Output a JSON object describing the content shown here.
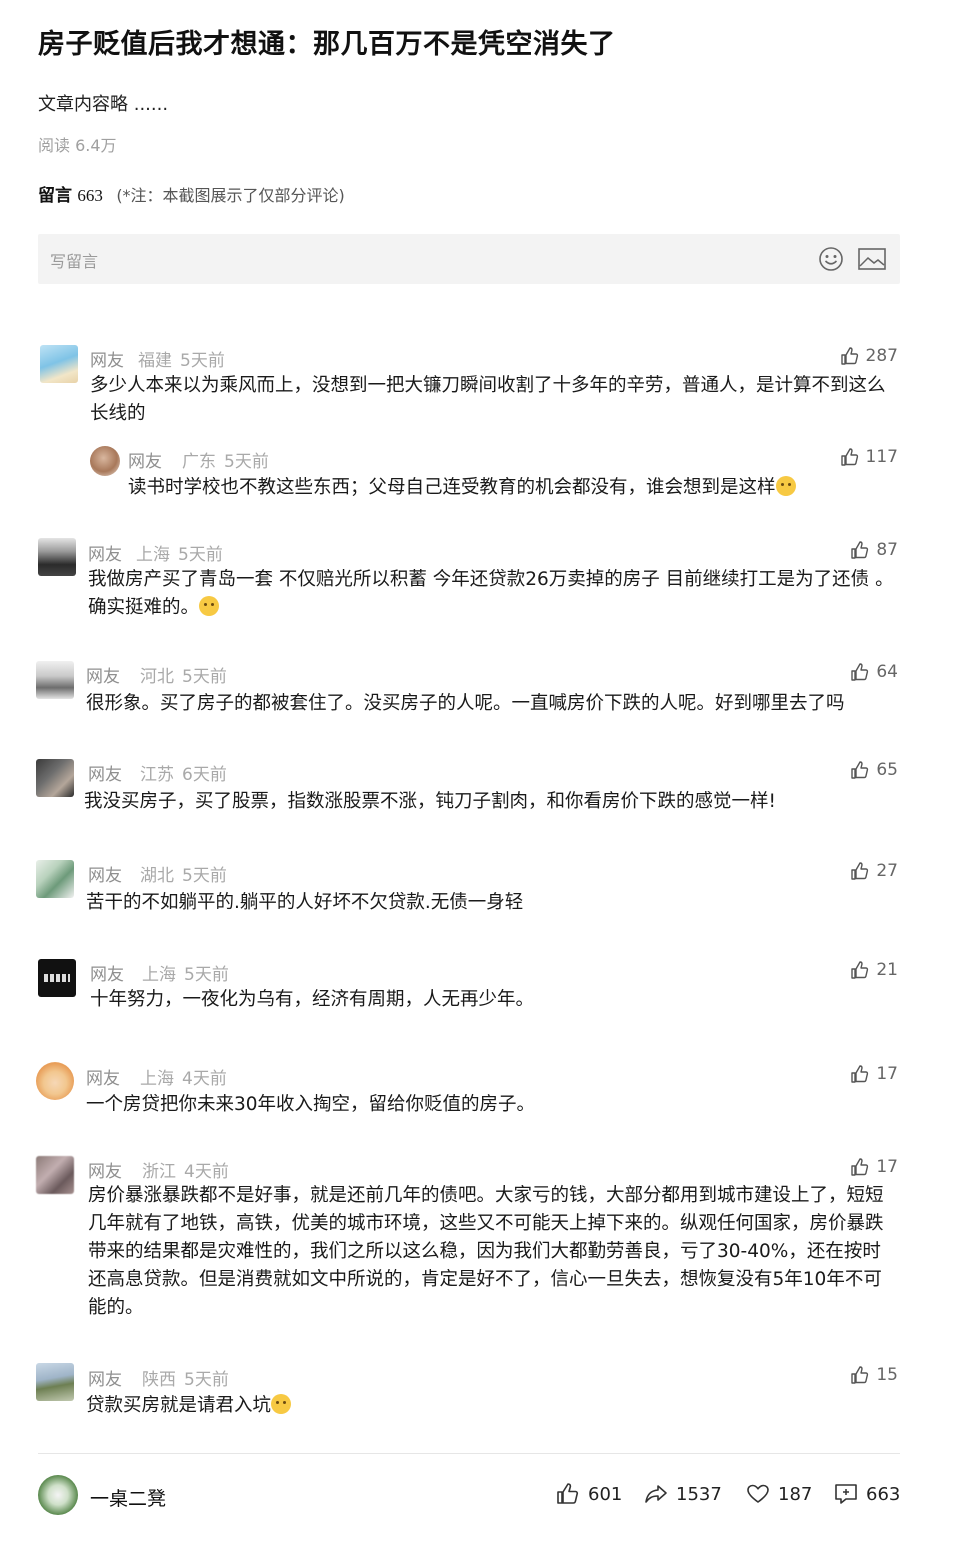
{
  "article": {
    "title": "房子贬值后我才想通：那几百万不是凭空消失了",
    "excerpt": "文章内容略 ......",
    "reads": "阅读 6.4万"
  },
  "comments_header": {
    "label": "留言",
    "count": "663",
    "note": "(*注：本截图展示了仅部分评论)"
  },
  "input": {
    "placeholder": "写留言",
    "emoji_icon": "smiley-icon",
    "image_icon": "image-icon"
  },
  "comments": [
    {
      "name": "网友",
      "region": "福建",
      "time": "5天前",
      "likes": "287",
      "text": "多少人本来以为乘风而上，没想到一把大镰刀瞬间收割了十多年的辛劳，普通人，是计算不到这么长线的"
    },
    {
      "name": "网友",
      "region": "广东",
      "time": "5天前",
      "likes": "117",
      "text": "读书时学校也不教这些东西；父母自己连受教育的机会都没有，谁会想到是这样"
    },
    {
      "name": "网友",
      "region": "上海",
      "time": "5天前",
      "likes": "87",
      "text": "我做房产买了青岛一套  不仅赔光所以积蓄 今年还贷款26万卖掉的房子   目前继续打工是为了还债  。确实挺难的。"
    },
    {
      "name": "网友",
      "region": "河北",
      "time": "5天前",
      "likes": "64",
      "text": "很形象。买了房子的都被套住了。没买房子的人呢。一直喊房价下跌的人呢。好到哪里去了吗"
    },
    {
      "name": "网友",
      "region": "江苏",
      "time": "6天前",
      "likes": "65",
      "text": "我没买房子，买了股票，指数涨股票不涨，钝刀子割肉，和你看房价下跌的感觉一样!"
    },
    {
      "name": "网友",
      "region": "湖北",
      "time": "5天前",
      "likes": "27",
      "text": "苦干的不如躺平的.躺平的人好坏不欠贷款.无债一身轻"
    },
    {
      "name": "网友",
      "region": "上海",
      "time": "5天前",
      "likes": "21",
      "text": "十年努力，一夜化为乌有，经济有周期，人无再少年。"
    },
    {
      "name": "网友",
      "region": "上海",
      "time": "4天前",
      "likes": "17",
      "text": "一个房贷把你未来30年收入掏空，留给你贬值的房子。"
    },
    {
      "name": "网友",
      "region": "浙江",
      "time": "4天前",
      "likes": "17",
      "text": "房价暴涨暴跌都不是好事，就是还前几年的债吧。大家亏的钱，大部分都用到城市建设上了，短短几年就有了地铁，高铁，优美的城市环境，这些又不可能天上掉下来的。纵观任何国家，房价暴跌带来的结果都是灾难性的，我们之所以这么稳，因为我们大都勤劳善良，亏了30-40%，还在按时还高息贷款。但是消费就如文中所说的，肯定是好不了，信心一旦失去，想恢复没有5年10年不可能的。"
    },
    {
      "name": "网友",
      "region": "陕西",
      "time": "5天前",
      "likes": "15",
      "text": "贷款买房就是请君入坑"
    }
  ],
  "footer": {
    "author": "一桌二凳",
    "likes": "601",
    "shares": "1537",
    "favorites": "187",
    "comments": "663"
  }
}
